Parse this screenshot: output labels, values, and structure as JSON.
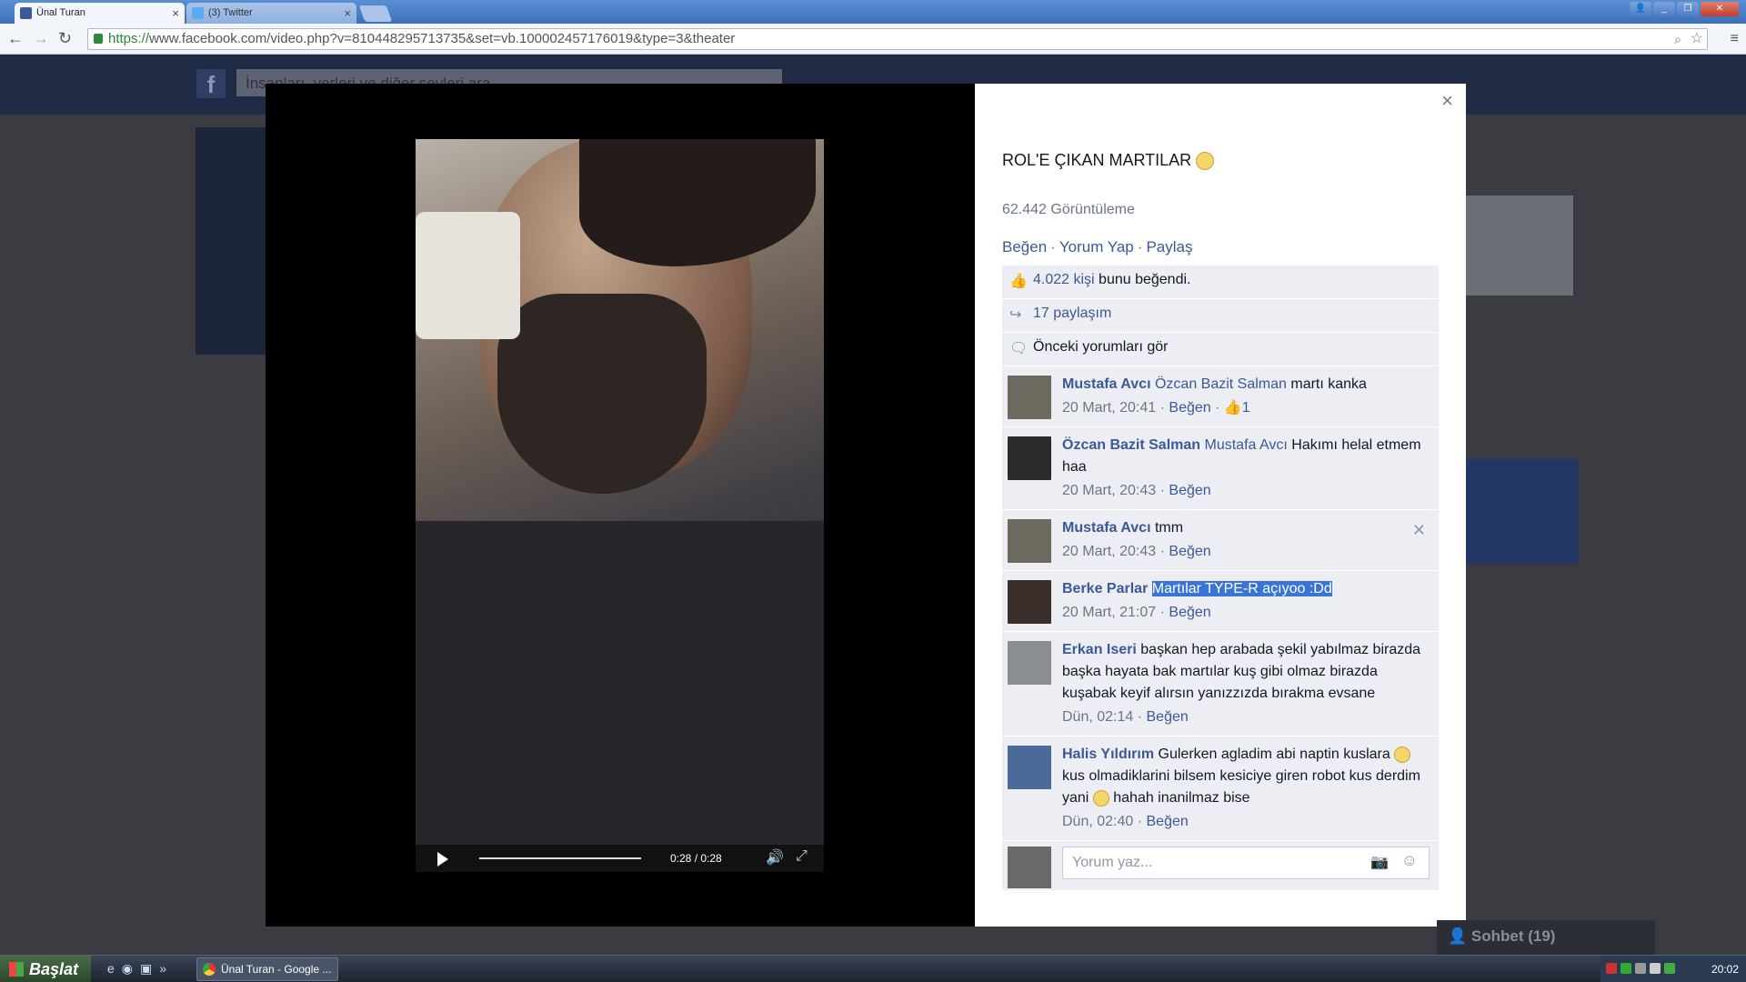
{
  "browser": {
    "tabs": [
      {
        "label": "Ünal Turan",
        "icon": "facebook-icon",
        "color": "#3b5998"
      },
      {
        "label": "(3) Twitter",
        "icon": "twitter-icon",
        "color": "#55acee"
      }
    ],
    "url_scheme": "https://",
    "url_rest": "www.facebook.com/video.php?v=810448295713735&set=vb.100002457176019&type=3&theater"
  },
  "facebook": {
    "search_placeholder": "İnsanları, yerleri ve diğer şeyleri ara"
  },
  "video": {
    "time": "0:28 / 0:28"
  },
  "panel": {
    "title": "ROL'E ÇIKAN MARTILAR",
    "views": "62.442 Görüntüleme",
    "actions": {
      "like": "Beğen",
      "comment": "Yorum Yap",
      "share": "Paylaş"
    },
    "likes_count": "4.022 kişi",
    "likes_suffix": " bunu beğendi.",
    "shares": "17 paylaşım",
    "previous_comments": "Önceki yorumları gör",
    "comments": [
      {
        "name": "Mustafa Avcı",
        "mention": "Özcan Bazit Salman",
        "text": " martı kanka",
        "time": "20 Mart, 20:41",
        "like": "Beğen",
        "likes": "1"
      },
      {
        "name": "Özcan Bazit Salman",
        "mention": "Mustafa Avcı",
        "text": " Hakımı helal etmem haa",
        "time": "20 Mart, 20:43",
        "like": "Beğen"
      },
      {
        "name": "Mustafa Avcı",
        "mention": "",
        "text": " tmm",
        "time": "20 Mart, 20:43",
        "like": "Beğen"
      },
      {
        "name": "Berke Parlar",
        "mention": "",
        "text": "Martılar TYPE-R açıyoo :Dd",
        "time": "20 Mart, 21:07",
        "like": "Beğen"
      },
      {
        "name": "Erkan Iseri",
        "mention": "",
        "text": " başkan hep arabada şekil yabılmaz birazda başka hayata bak martılar kuş gibi olmaz birazda kuşabak keyif alırsın yanızzızda bırakma evsane",
        "time": "Dün, 02:14",
        "like": "Beğen"
      },
      {
        "name": "Halis Yıldırım",
        "mention": "",
        "text1": " Gulerken agladim abi naptin kuslara ",
        "text2": " kus olmadiklarini bilsem kesiciye giren robot kus derdim yani ",
        "text3": " hahah inanilmaz bise",
        "time": "Dün, 02:40",
        "like": "Beğen"
      }
    ],
    "reply_placeholder": "Yorum yaz..."
  },
  "chat": {
    "label": "Sohbet (19)"
  },
  "taskbar": {
    "start": "Başlat",
    "item": "Ünal Turan - Google ...",
    "clock": "20:02"
  }
}
